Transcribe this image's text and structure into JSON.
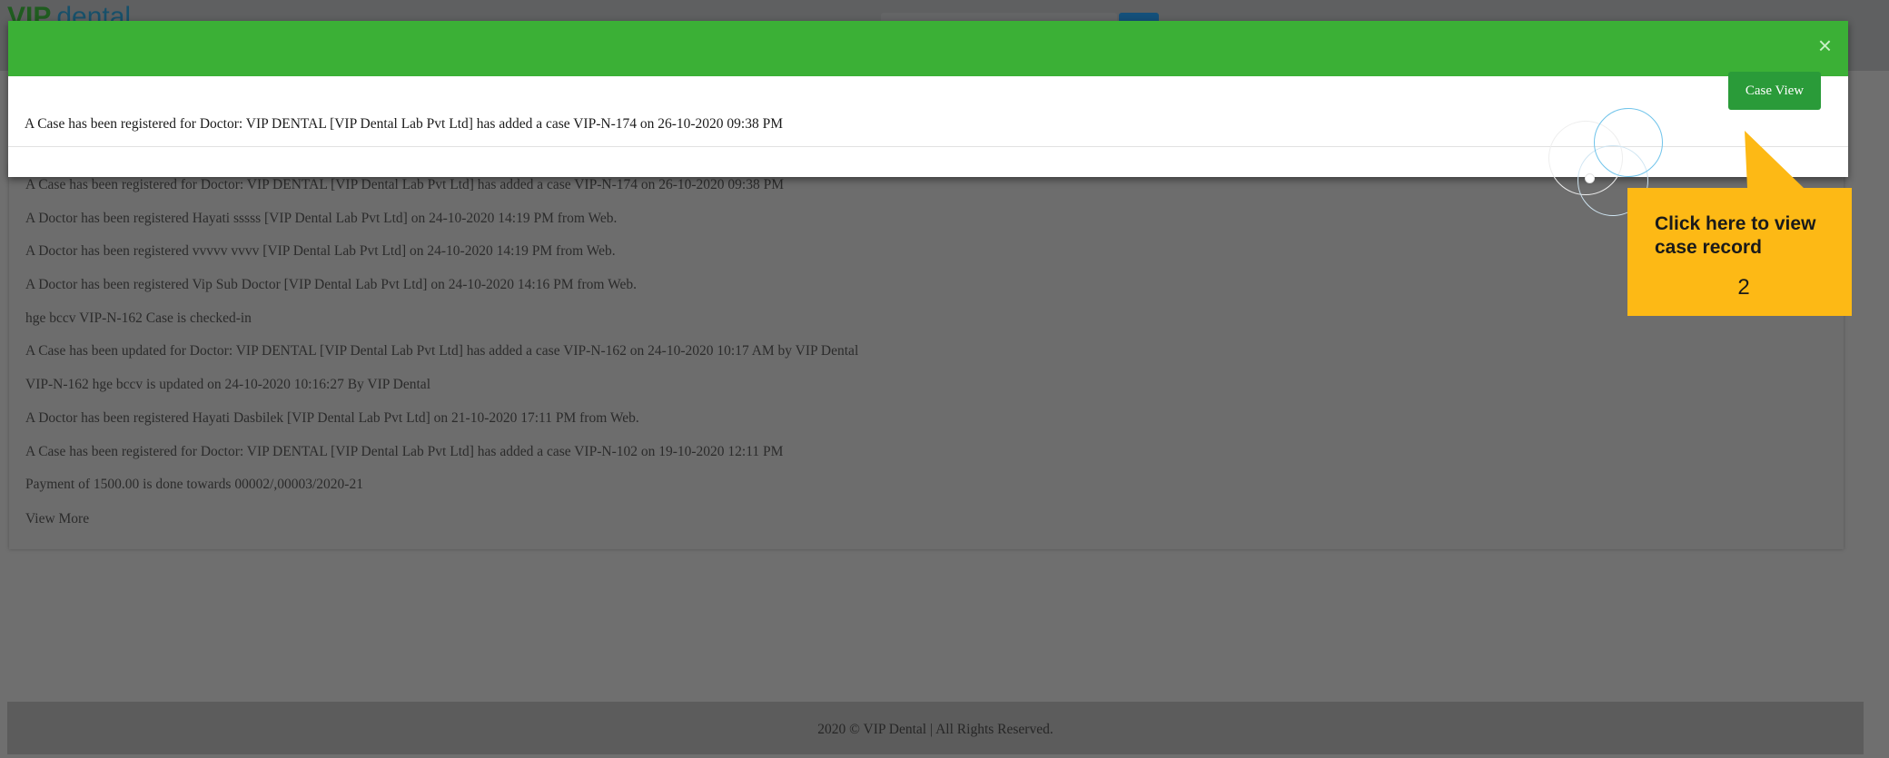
{
  "header": {
    "logo_part1": "VIP",
    "logo_part2": "dental"
  },
  "notifications": [
    "A Case has been registered for Doctor: VIP DENTAL [VIP Dental Lab Pvt Ltd] has added a case VIP-N-174 on 26-10-2020 09:38 PM",
    "A Doctor has been registered Hayati sssss [VIP Dental Lab Pvt Ltd] on 24-10-2020 14:19 PM from Web.",
    "A Doctor has been registered vvvvv vvvv [VIP Dental Lab Pvt Ltd] on 24-10-2020 14:19 PM from Web.",
    "A Doctor has been registered Vip Sub Doctor [VIP Dental Lab Pvt Ltd] on 24-10-2020 14:16 PM from Web.",
    "hge bccv VIP-N-162 Case is checked-in",
    "A Case has been updated for Doctor: VIP DENTAL [VIP Dental Lab Pvt Ltd] has added a case VIP-N-162 on 24-10-2020 10:17 AM by VIP Dental",
    "VIP-N-162 hge bccv is updated on 24-10-2020 10:16:27 By VIP Dental",
    "A Doctor has been registered Hayati Dasbilek [VIP Dental Lab Pvt Ltd] on 21-10-2020 17:11 PM from Web.",
    "A Case has been registered for Doctor: VIP DENTAL [VIP Dental Lab Pvt Ltd] has added a case VIP-N-102 on 19-10-2020 12:11 PM",
    "Payment of 1500.00 is done towards 00002/,00003/2020-21"
  ],
  "view_more_label": "View More",
  "footer": {
    "text": "2020 © VIP Dental | All Rights Reserved."
  },
  "modal": {
    "close_label": "×",
    "message": "A Case has been registered for Doctor: VIP DENTAL [VIP Dental Lab Pvt Ltd] has added a case VIP-N-174 on 26-10-2020 09:38 PM",
    "case_view_label": "Case View",
    "header_color": "#3bb036",
    "button_color": "#2a9b39"
  },
  "callout": {
    "text": "Click here to view case record",
    "step": "2",
    "color": "#fdb915"
  }
}
